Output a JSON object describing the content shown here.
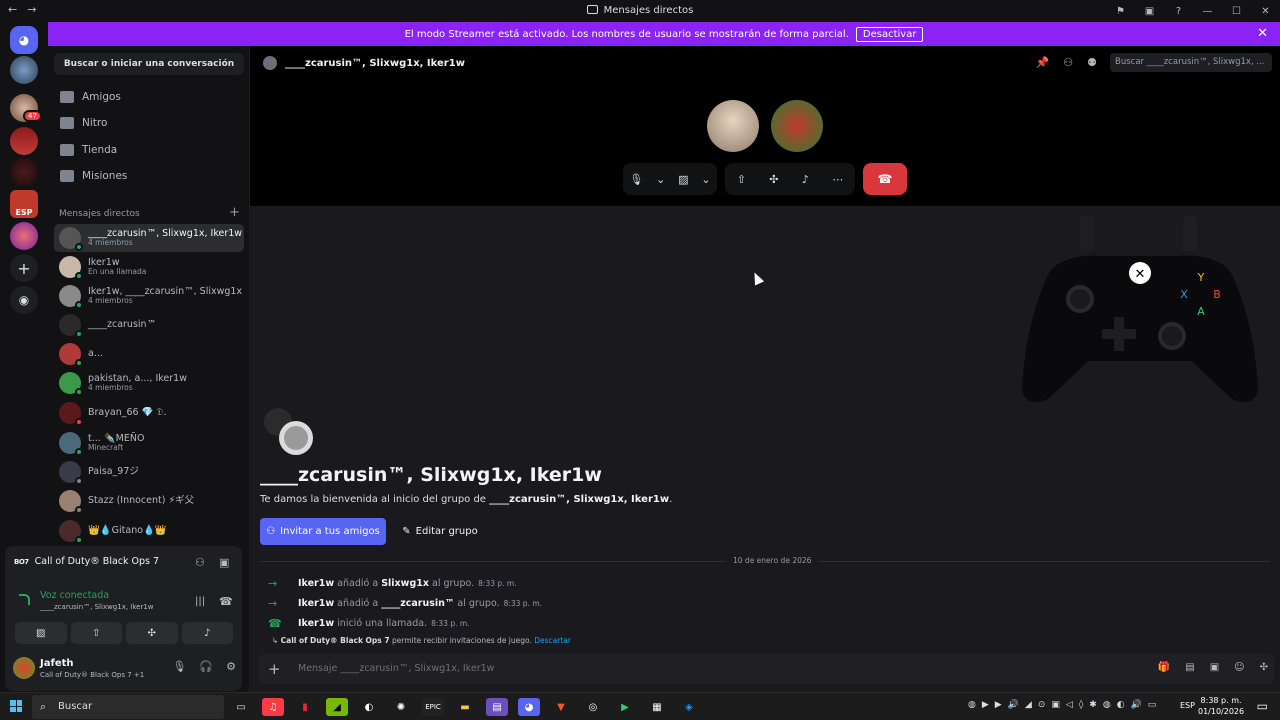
{
  "window": {
    "title": "Mensajes directos"
  },
  "banner": {
    "text": "El modo Streamer está activado. Los nombres de usuario se mostrarán de forma parcial.",
    "button": "Desactivar"
  },
  "servers": {
    "esp_label": "ESP",
    "badge": "47"
  },
  "sidebar": {
    "search": "Buscar o iniciar una conversación",
    "nav": [
      "Amigos",
      "Nitro",
      "Tienda",
      "Misiones"
    ],
    "dm_header": "Mensajes directos",
    "dms": [
      {
        "name": "____zcarusin™, Slixwg1x, Iker1w",
        "sub": "4 miembros"
      },
      {
        "name": "Iker1w",
        "sub": "En una llamada"
      },
      {
        "name": "Iker1w, ____zcarusin™, Slixwg1x",
        "sub": "4 miembros"
      },
      {
        "name": "____zcarusin™",
        "sub": ""
      },
      {
        "name": "a...",
        "sub": ""
      },
      {
        "name": "pakistan, a..., Iker1w",
        "sub": "4 miembros"
      },
      {
        "name": "Brayan_66 💎 𝔇.",
        "sub": ""
      },
      {
        "name": "t... ✒️MEÑO",
        "sub": "Minecraft"
      },
      {
        "name": "Paisa_97ジ",
        "sub": ""
      },
      {
        "name": "Stazz (Innocent) ⚡ギ父",
        "sub": ""
      },
      {
        "name": "👑💧Gitano💧👑",
        "sub": ""
      }
    ]
  },
  "voice": {
    "game": "Call of Duty® Black Ops 7",
    "game_logo": "BO7",
    "status": "Voz conectada",
    "channel": "____zcarusin™, Slixwg1x, Iker1w"
  },
  "user": {
    "name": "Jafeth",
    "activity": "Call of Duty® Black Ops 7 +1"
  },
  "main": {
    "group_name": "____zcarusin™, Slixwg1x, Iker1w",
    "search_placeholder": "Buscar ____zcarusin™, Slixwg1x, ...",
    "welcome_title": "____zcarusin™, Slixwg1x, Iker1w",
    "welcome_prefix": "Te damos la bienvenida al inicio del grupo de ",
    "welcome_group": "____zcarusin™, Slixwg1x, Iker1w",
    "welcome_suffix": ".",
    "invite_button": "Invitar a tus amigos",
    "edit_button": "Editar grupo",
    "date": "10 de enero de 2026",
    "messages": [
      {
        "user": "Iker1w",
        "verb": "añadió a",
        "target": "Slixwg1x",
        "rest": "al grupo.",
        "time": "8:33 p. m."
      },
      {
        "user": "Iker1w",
        "verb": "añadió a",
        "target": "____zcarusin™",
        "rest": "al grupo.",
        "time": "8:33 p. m."
      },
      {
        "user": "Iker1w",
        "verb": "inició una llamada.",
        "target": "",
        "rest": "",
        "time": "8:33 p. m."
      }
    ],
    "game_note_game": "Call of Duty® Black Ops 7",
    "game_note_text": " permite recibir invitaciones de juego. ",
    "game_note_link": "Descartar",
    "composer_placeholder": "Mensaje ____zcarusin™, Slixwg1x, Iker1w"
  },
  "taskbar": {
    "search": "Buscar",
    "lang": "ESP",
    "time": "8:38 p. m.",
    "date": "01/10/2026"
  },
  "colors": {
    "accent": "#5865f2",
    "banner": "#8b23f5",
    "online": "#23a55a",
    "danger": "#da373c"
  }
}
